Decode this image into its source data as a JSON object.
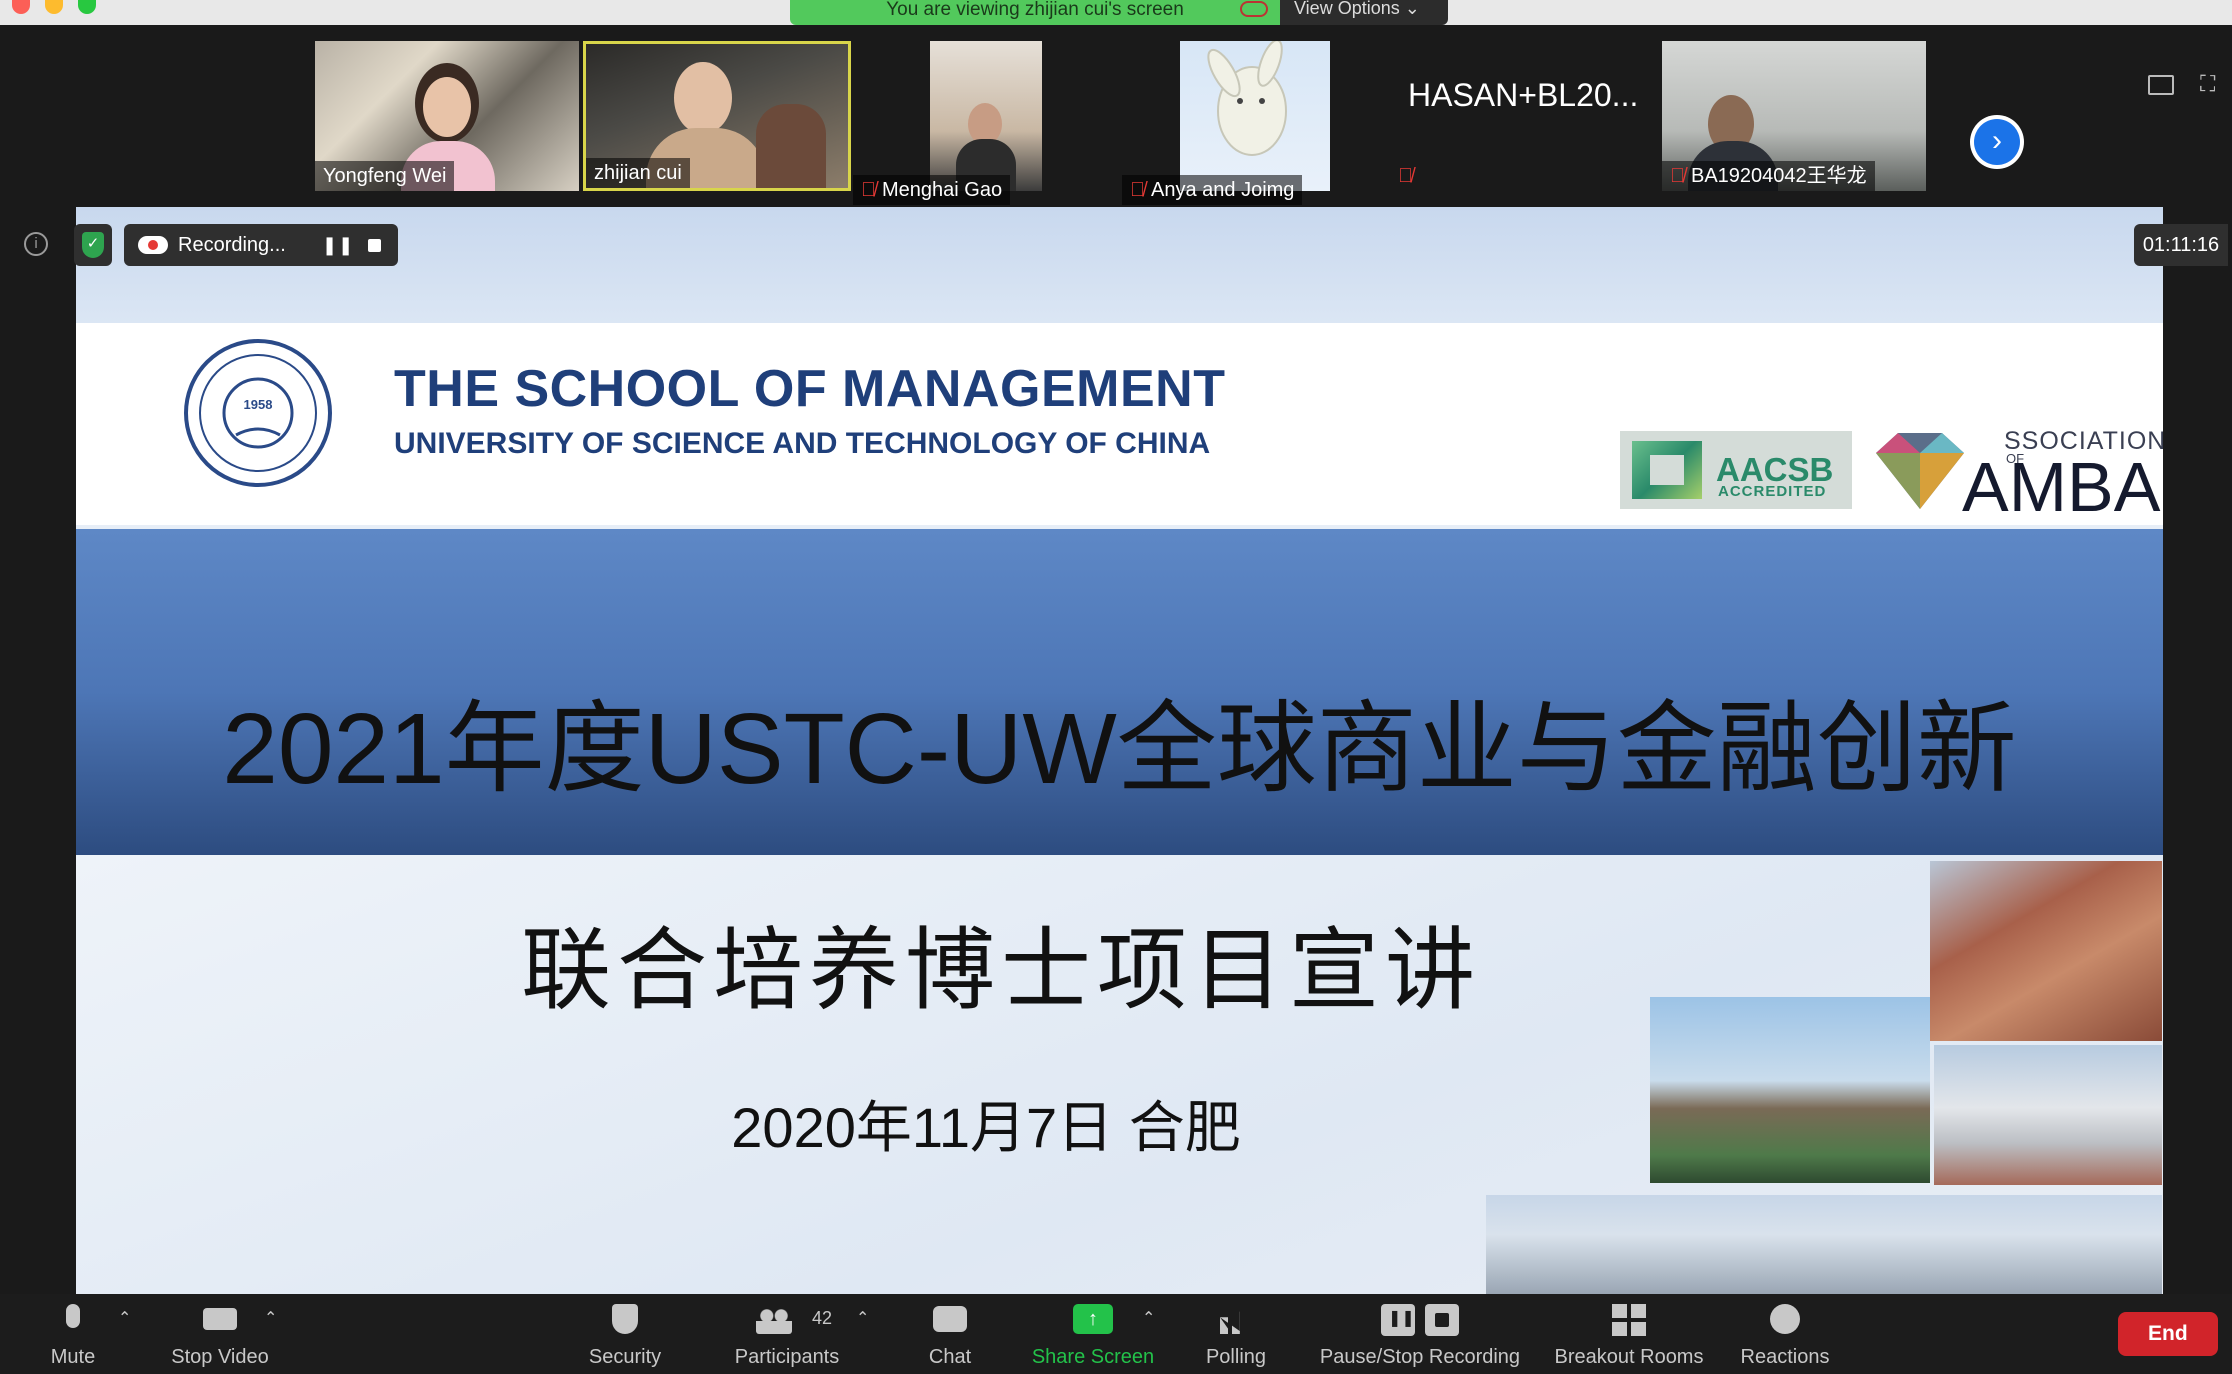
{
  "window": {
    "viewing_banner": "You are viewing zhijian cui's screen",
    "view_options": "View Options ⌄"
  },
  "gallery": {
    "participants": [
      {
        "name": "Yongfeng Wei",
        "muted": false
      },
      {
        "name": "zhijian cui",
        "muted": false,
        "active_speaker": true
      },
      {
        "name": "Menghai Gao",
        "muted": true
      },
      {
        "name": "Anya and Joimg",
        "muted": true
      },
      {
        "name": "HASAN+BL20...",
        "muted": true,
        "video_off": true
      },
      {
        "name": "BA19204042王华龙",
        "muted": true
      }
    ],
    "next_page_icon": "chevron-right-icon"
  },
  "status": {
    "recording_label": "Recording...",
    "timer": "01:11:16"
  },
  "slide": {
    "school_title": "THE SCHOOL OF MANAGEMENT",
    "school_subtitle": "UNIVERSITY OF SCIENCE AND TECHNOLOGY OF CHINA",
    "seal_year": "1958",
    "aacsb_main": "AACSB",
    "aacsb_sub": "ACCREDITED",
    "amba_assoc": "SSOCIATION",
    "amba_of": "OF",
    "amba_main": "AMBA",
    "main_title": "2021年度USTC-UW全球商业与金融创新",
    "subtitle": "联合培养博士项目宣讲",
    "date_line": "2020年11月7日 合肥"
  },
  "toolbar": {
    "mute": "Mute",
    "stop_video": "Stop Video",
    "security": "Security",
    "participants": "Participants",
    "participants_count": "42",
    "chat": "Chat",
    "share_screen": "Share Screen",
    "polling": "Polling",
    "pause_stop_recording": "Pause/Stop Recording",
    "breakout_rooms": "Breakout Rooms",
    "reactions": "Reactions",
    "end": "End"
  },
  "colors": {
    "accent_green": "#23c24a",
    "end_red": "#d1242a",
    "speaker_border": "#d8d54a",
    "banner_blue": "#4d76b6",
    "school_navy": "#1f3f7a"
  }
}
